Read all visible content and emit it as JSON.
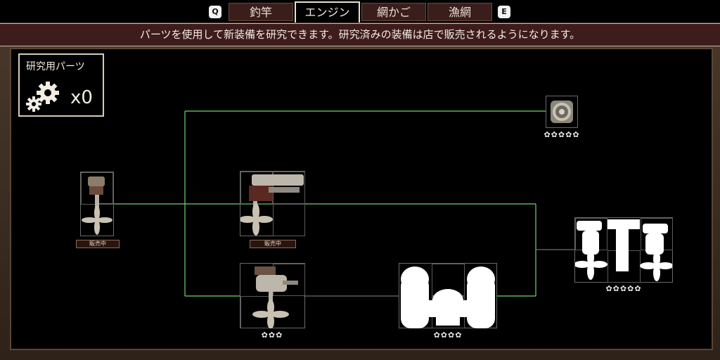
{
  "tabs": {
    "prev_key": "Q",
    "next_key": "E",
    "items": [
      "釣竿",
      "エンジン",
      "網かご",
      "漁網"
    ],
    "active": "エンジン"
  },
  "banner": {
    "text": "パーツを使用して新装備を研究できます。研究済みの装備は店で販売されるようになります。"
  },
  "research_parts": {
    "label": "研究用パーツ",
    "count": "x0",
    "icon": "gears-icon"
  },
  "nodes": {
    "engine_1": {
      "badge": "販売中",
      "icon": "outboard-engine-small-icon"
    },
    "engine_2": {
      "badge": "販売中",
      "icon": "outboard-engine-large-icon"
    },
    "engine_3": {
      "stars": "✿✿✿",
      "icon": "outboard-engine-propeller-icon"
    },
    "engine_4": {
      "stars": "✿✿✿✿",
      "icon": "locked-engine-silhouette-icon"
    },
    "engine_5": {
      "stars": "✿✿✿✿✿",
      "icon": "locked-twin-engine-silhouette-icon"
    },
    "engine_6": {
      "stars": "✿✿✿✿✿",
      "icon": "turbine-engine-icon"
    }
  },
  "colors": {
    "connector": "#6fd36f",
    "banner_bg": "#3e1c1c",
    "tab_bg": "#3a1e1c"
  }
}
